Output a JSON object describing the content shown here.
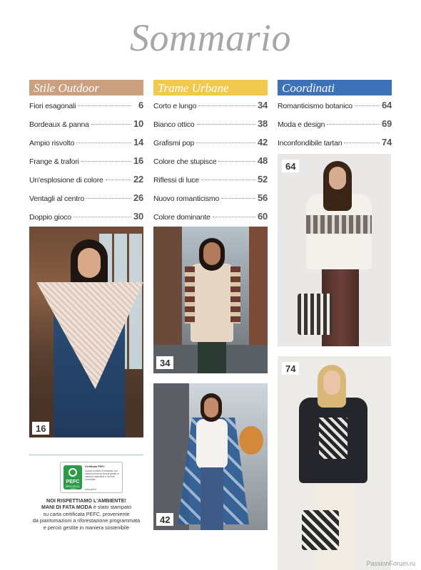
{
  "title": "Sommario",
  "sections": [
    {
      "name": "Stile Outdoor",
      "color": "#caa080",
      "items": [
        {
          "label": "Fiori esagonali",
          "page": "6"
        },
        {
          "label": "Bordeaux & panna",
          "page": "10"
        },
        {
          "label": "Ampio risvolto",
          "page": "14"
        },
        {
          "label": "Frange & trafori",
          "page": "16"
        },
        {
          "label": "Un'esplosione di colore",
          "page": "22"
        },
        {
          "label": "Ventagli al centro",
          "page": "26"
        },
        {
          "label": "Doppio gioco",
          "page": "30"
        }
      ]
    },
    {
      "name": "Trame Urbane",
      "color": "#f2c94f",
      "items": [
        {
          "label": "Corto e lungo",
          "page": "34"
        },
        {
          "label": "Bianco ottico",
          "page": "38"
        },
        {
          "label": "Grafismi pop",
          "page": "42"
        },
        {
          "label": "Colore che stupisce",
          "page": "48"
        },
        {
          "label": "Riflessi di luce",
          "page": "52"
        },
        {
          "label": "Nuovo romanticismo",
          "page": "56"
        },
        {
          "label": "Colore dominante",
          "page": "60"
        }
      ]
    },
    {
      "name": "Coordinati",
      "color": "#3d72b7",
      "items": [
        {
          "label": "Romanticismo botanico",
          "page": "64"
        },
        {
          "label": "Moda e design",
          "page": "69"
        },
        {
          "label": "Inconfondibile tartan",
          "page": "74"
        }
      ]
    }
  ],
  "photos": {
    "p16": "16",
    "p34": "34",
    "p42": "42",
    "p64": "64",
    "p74": "74"
  },
  "eco": {
    "pefc_name": "PEFC",
    "pefc_code": "PEFC/18-31-1234",
    "pefc_title": "Certificato PEFC",
    "pefc_body": "Questo prodotto è realizzato con materia prima da foreste gestite in maniera sostenibile e da fonti controllate",
    "pefc_url": "www.pefc.it",
    "line1": "NOI RISPETTIAMO L'AMBIENTE!",
    "line2_bold": "MANI DI FATA MODA",
    "line2_rest": " è stato stampato",
    "line3": "su carta certificata PEFC, proveniente",
    "line4": "da piantumazioni a riforestazione programmata",
    "line5": "e perciò gestite in maniera sostenibile"
  },
  "watermark": "PassionForum.ru"
}
